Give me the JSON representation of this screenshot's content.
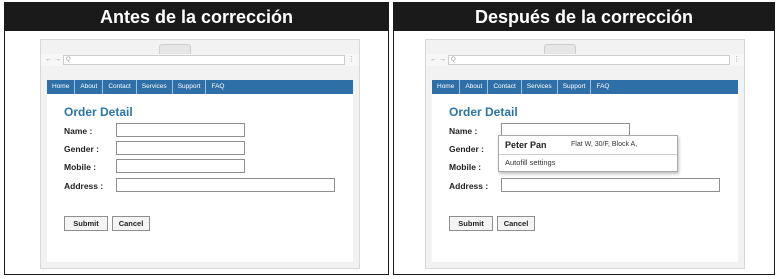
{
  "panels": {
    "before": {
      "title": "Antes de la corrección"
    },
    "after": {
      "title": "Después de la corrección"
    }
  },
  "browser": {
    "nav_icons": "← → ↻ ",
    "address_placeholder": "Q",
    "menu_icon": "⋮"
  },
  "nav": {
    "items": [
      "Home",
      "About",
      "Contact",
      "Services",
      "Support",
      "FAQ"
    ]
  },
  "form": {
    "title": "Order Detail",
    "labels": {
      "name": "Name :",
      "gender": "Gender :",
      "mobile": "Mobile :",
      "address": "Address :"
    },
    "submit_label": "Submit",
    "cancel_label": "Cancel"
  },
  "autofill": {
    "name": "Peter Pan",
    "address": "Flat W, 30/F, Block A,",
    "settings_label": "Autofill settings"
  },
  "colors": {
    "header_bg": "#1a1a1a",
    "nav_bg": "#2f6fa8",
    "title_color": "#2c76a4"
  }
}
